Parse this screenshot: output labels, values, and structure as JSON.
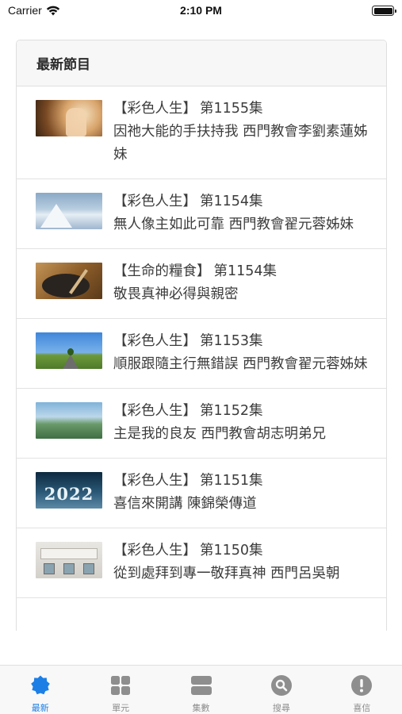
{
  "status_bar": {
    "carrier": "Carrier",
    "time": "2:10 PM"
  },
  "section": {
    "title": "最新節目"
  },
  "episodes": [
    {
      "series": "【彩色人生】",
      "episode": "第1155集",
      "description": "因祂大能的手扶持我 西門教會李劉素蓮姊妹",
      "thumb": "hand"
    },
    {
      "series": "【彩色人生】",
      "episode": "第1154集",
      "description": "無人像主如此可靠 西門教會翟元蓉姊妹",
      "thumb": "snow"
    },
    {
      "series": "【生命的糧食】",
      "episode": "第1154集",
      "description": "敬畏真神必得與親密",
      "thumb": "food"
    },
    {
      "series": "【彩色人生】",
      "episode": "第1153集",
      "description": "順服跟隨主行無錯誤 西門教會翟元蓉姊妹",
      "thumb": "road"
    },
    {
      "series": "【彩色人生】",
      "episode": "第1152集",
      "description": "主是我的良友 西門教會胡志明弟兄",
      "thumb": "hill"
    },
    {
      "series": "【彩色人生】",
      "episode": "第1151集",
      "description": "喜信來開講 陳錦榮傳道",
      "thumb": "2022"
    },
    {
      "series": "【彩色人生】",
      "episode": "第1150集",
      "description": "從到處拜到專一敬拜真神 西門呂吳朝",
      "thumb": "building"
    }
  ],
  "thumb_texts": {
    "year": "2022"
  },
  "tabbar": {
    "active_color": "#1c7fe6",
    "inactive_color": "#8e8e8e",
    "tabs": [
      {
        "label": "最新",
        "icon": "badge-icon",
        "active": true
      },
      {
        "label": "單元",
        "icon": "grid-icon",
        "active": false
      },
      {
        "label": "集數",
        "icon": "list-icon",
        "active": false
      },
      {
        "label": "搜尋",
        "icon": "search-icon",
        "active": false
      },
      {
        "label": "喜信",
        "icon": "alert-icon",
        "active": false
      }
    ]
  }
}
